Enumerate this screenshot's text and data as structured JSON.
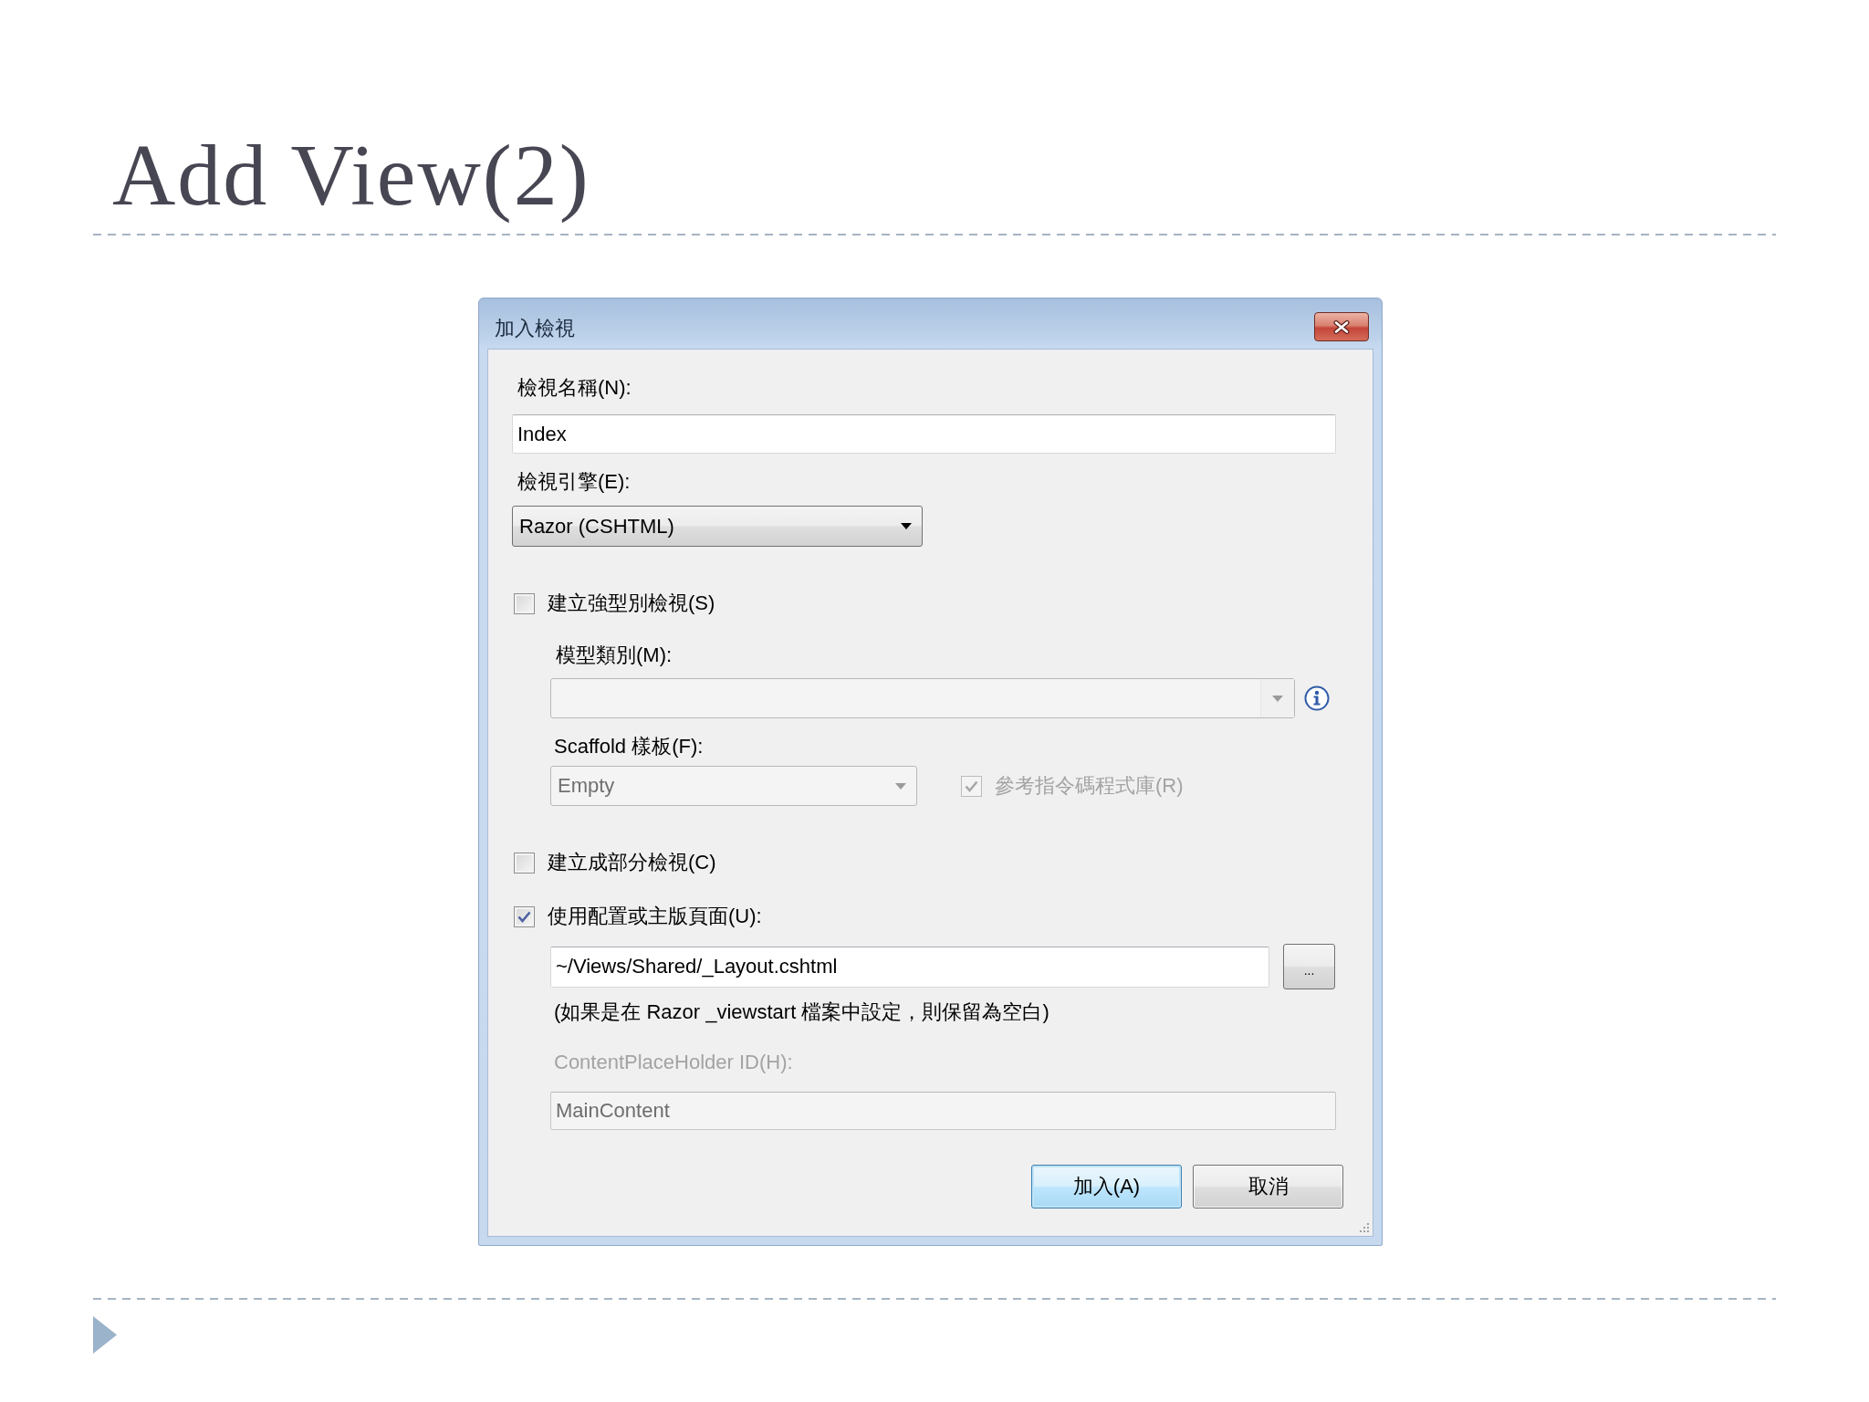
{
  "slide": {
    "title": "Add View(2)"
  },
  "dialog": {
    "title": "加入檢視",
    "view_name": {
      "label": "檢視名稱(N):",
      "value": "Index"
    },
    "view_engine": {
      "label": "檢視引擎(E):",
      "value": "Razor (CSHTML)"
    },
    "strongly_typed": {
      "label": "建立強型別檢視(S)",
      "checked": false
    },
    "model_class": {
      "label": "模型類別(M):",
      "disabled": true
    },
    "scaffold": {
      "label": "Scaffold 樣板(F):",
      "value": "Empty",
      "disabled": true
    },
    "reference_scripts": {
      "label": "參考指令碼程式庫(R)",
      "checked": true,
      "disabled": true
    },
    "partial_view": {
      "label": "建立成部分檢視(C)",
      "checked": false
    },
    "use_layout": {
      "label": "使用配置或主版頁面(U):",
      "checked": true
    },
    "layout_path": {
      "value": "~/Views/Shared/_Layout.cshtml",
      "browse_label": "..."
    },
    "layout_hint": "(如果是在 Razor _viewstart 檔案中設定，則保留為空白)",
    "content_placeholder": {
      "label": "ContentPlaceHolder ID(H):",
      "value": "MainContent",
      "disabled": true
    },
    "buttons": [
      {
        "label": "加入(A)",
        "default": true
      },
      {
        "label": "取消",
        "default": false
      }
    ]
  }
}
